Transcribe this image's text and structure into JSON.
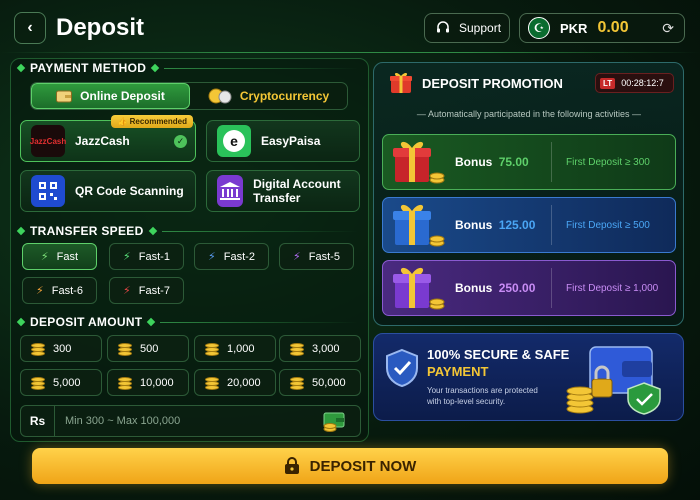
{
  "header": {
    "title": "Deposit",
    "support_label": "Support",
    "currency": "PKR",
    "balance": "0.00"
  },
  "payment_method": {
    "section_label": "PAYMENT METHOD",
    "tabs": [
      {
        "label": "Online Deposit"
      },
      {
        "label": "Cryptocurrency"
      }
    ],
    "methods": [
      {
        "label": "JazzCash",
        "badge": "Recommended",
        "logo_text": "JazzCash"
      },
      {
        "label": "EasyPaisa"
      },
      {
        "label": "QR Code Scanning"
      },
      {
        "label": "Digital Account Transfer"
      }
    ]
  },
  "transfer_speed": {
    "section_label": "TRANSFER SPEED",
    "options": [
      {
        "label": "Fast",
        "color": "#7ee07a"
      },
      {
        "label": "Fast-1",
        "color": "#58e07a"
      },
      {
        "label": "Fast-2",
        "color": "#5a9cf5"
      },
      {
        "label": "Fast-5",
        "color": "#b26cf5"
      },
      {
        "label": "Fast-6",
        "color": "#f5a23a"
      },
      {
        "label": "Fast-7",
        "color": "#e64646"
      }
    ]
  },
  "deposit_amount": {
    "section_label": "DEPOSIT AMOUNT",
    "amounts": [
      "300",
      "500",
      "1,000",
      "3,000",
      "5,000",
      "10,000",
      "20,000",
      "50,000"
    ],
    "currency_prefix": "Rs",
    "placeholder": "Min 300 ~ Max 100,000"
  },
  "promotion": {
    "title": "DEPOSIT PROMOTION",
    "timer_badge": "LT",
    "timer": "00:28:12:7",
    "subtitle": "Automatically participated in the following activities",
    "bonuses": [
      {
        "label": "Bonus",
        "amount": "75.00",
        "condition": "First Deposit ≥ 300",
        "color": "#5ed06a"
      },
      {
        "label": "Bonus",
        "amount": "125.00",
        "condition": "First Deposit ≥ 500",
        "color": "#4aa6f5"
      },
      {
        "label": "Bonus",
        "amount": "250.00",
        "condition": "First Deposit ≥ 1,000",
        "color": "#c88cf5"
      }
    ]
  },
  "secure": {
    "title_line1": "100% SECURE & SAFE",
    "title_line2": "PAYMENT",
    "description": "Your transactions are protected with top-level security."
  },
  "deposit_button": {
    "label": "DEPOSIT NOW"
  }
}
